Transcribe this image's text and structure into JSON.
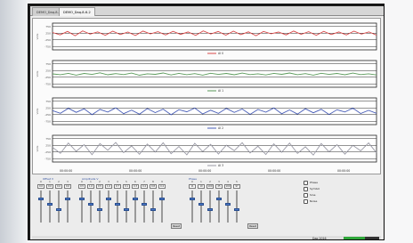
{
  "window": {
    "tabs": [
      {
        "label": "DEMO_Daq-8-6-1"
      },
      {
        "label": "DEMO_Daq-8-6-2"
      }
    ]
  },
  "chart_data": [
    {
      "type": "line",
      "ylabel": "Volts",
      "yticks": [
        "750",
        "250",
        "-250",
        "-750"
      ],
      "series": [
        {
          "name": "AI 0",
          "color": "#d84a4a",
          "values": [
            300,
            120,
            380,
            60,
            420,
            180,
            350,
            90,
            400,
            150,
            330,
            70,
            410,
            200,
            360,
            110,
            390,
            160,
            340,
            80,
            420,
            190,
            370,
            100,
            400,
            140,
            350,
            60,
            380,
            210,
            330,
            120,
            410,
            170,
            360,
            90,
            390,
            150,
            340,
            110,
            400,
            180,
            350,
            100
          ]
        }
      ]
    },
    {
      "type": "line",
      "ylabel": "Volts",
      "yticks": [
        "750",
        "250",
        "-250",
        "-750"
      ],
      "series": [
        {
          "name": "AI 1",
          "color": "#5a9a5a",
          "values": [
            0,
            -60,
            40,
            -90,
            30,
            -40,
            80,
            -70,
            20,
            -50,
            60,
            -100,
            10,
            -30,
            70,
            -80,
            40,
            -60,
            20,
            -90,
            50,
            -40,
            30,
            -70,
            60,
            -50,
            10,
            -80,
            40,
            -30,
            70,
            -60,
            20,
            -90,
            50,
            -40,
            30,
            -70,
            60,
            -50,
            10,
            -80
          ]
        }
      ]
    },
    {
      "type": "line",
      "ylabel": "Volts",
      "yticks": [
        "750",
        "250",
        "-250",
        "-750"
      ],
      "series": [
        {
          "name": "AI 2",
          "color": "#4a5fb8",
          "values": [
            50,
            -150,
            220,
            -80,
            180,
            -250,
            140,
            -60,
            260,
            -180,
            90,
            -220,
            200,
            -100,
            160,
            -260,
            120,
            -40,
            240,
            -200,
            80,
            -160,
            210,
            -90,
            170,
            -230,
            130,
            -70,
            250,
            -190,
            100,
            -210,
            190,
            -110,
            150,
            -240,
            110,
            -50,
            230,
            -170,
            70,
            -150
          ]
        }
      ]
    },
    {
      "type": "line",
      "ylabel": "Volts",
      "yticks": [
        "750",
        "250",
        "-250",
        "-750"
      ],
      "series": [
        {
          "name": "AI 3",
          "color": "#9a9aa6",
          "values": [
            100,
            -350,
            420,
            -200,
            300,
            -450,
            380,
            -120,
            460,
            -300,
            200,
            -420,
            350,
            -250,
            440,
            -380,
            160,
            -460,
            400,
            -220,
            320,
            -400,
            260,
            -150,
            450,
            -330,
            180,
            -440,
            360,
            -270,
            420,
            -360,
            140,
            -480,
            390,
            -240,
            300,
            -410,
            250,
            -160,
            430,
            -310
          ]
        }
      ]
    }
  ],
  "time_labels": [
    "00:00:00",
    "00:00:00",
    "00:00:00",
    "00:00:00",
    "00:00:00"
  ],
  "controls": {
    "offset_group": {
      "title": "Offset V",
      "columns": [
        {
          "hdr": "0",
          "val": "0.0"
        },
        {
          "hdr": "1",
          "val": "0.0"
        },
        {
          "hdr": "2",
          "val": "0.0"
        },
        {
          "hdr": "3",
          "val": "0.0"
        }
      ]
    },
    "amplitude_group": {
      "title": "Amplitude V",
      "columns": [
        {
          "hdr": "0",
          "val": "0.5"
        },
        {
          "hdr": "1",
          "val": "1.0"
        },
        {
          "hdr": "2",
          "val": "0.5"
        },
        {
          "hdr": "3",
          "val": "1.0"
        },
        {
          "hdr": "4",
          "val": "0.7"
        },
        {
          "hdr": "5",
          "val": "0.1"
        },
        {
          "hdr": "6",
          "val": "0.3"
        },
        {
          "hdr": "7",
          "val": "0.4"
        },
        {
          "hdr": "8",
          "val": "0.8"
        },
        {
          "hdr": "9",
          "val": "0.4"
        }
      ]
    },
    "phase_group": {
      "title": "Phase",
      "columns": [
        {
          "hdr": "0",
          "val": "11"
        },
        {
          "hdr": "1",
          "val": "10"
        },
        {
          "hdr": "2",
          "val": "100"
        },
        {
          "hdr": "3",
          "val": "25"
        },
        {
          "hdr": "4",
          "val": "100"
        },
        {
          "hdr": "5",
          "val": "97"
        }
      ]
    },
    "reset_label": "Reset",
    "options": [
      {
        "label": "Phase"
      },
      {
        "label": "Symbol"
      },
      {
        "label": "Sine"
      },
      {
        "label": "Noise"
      }
    ]
  },
  "status": {
    "text": "Daq 2016",
    "meter_fraction": 0.6,
    "meter_color": "#2fa83a"
  }
}
